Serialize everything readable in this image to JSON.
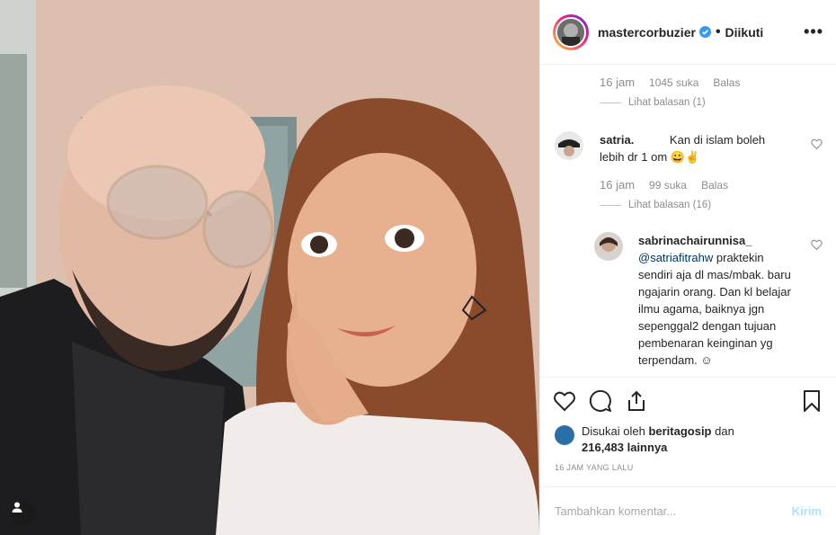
{
  "header": {
    "username": "mastercorbuzier",
    "separator": "•",
    "follow_status": "Diikuti",
    "more": "•••"
  },
  "comments": [
    {
      "meta": {
        "time": "16 jam",
        "likes": "1045 suka",
        "reply": "Balas"
      },
      "view_replies": "Lihat balasan (1)"
    },
    {
      "username": "satria.",
      "text": " Kan di islam boleh lebih dr 1 om 😀✌",
      "meta": {
        "time": "16 jam",
        "likes": "99 suka",
        "reply": "Balas"
      },
      "view_replies": "Lihat balasan (16)"
    },
    {
      "username": "sabrinachairunnisa_",
      "mention": "@satriafitrahw",
      "text": " praktekin sendiri aja dl mas/mbak. baru ngajarin orang. Dan kl belajar ilmu agama, baiknya jgn sepenggal2 dengan tujuan pembenaran keinginan yg terpendam. ☺"
    }
  ],
  "liked_by": {
    "prefix": "Disukai oleh ",
    "user": "beritagosip",
    "connector": " dan",
    "count": "216,483 lainnya"
  },
  "timestamp": "16 JAM YANG LALU",
  "add_comment": {
    "placeholder": "Tambahkan komentar...",
    "send": "Kirim"
  },
  "icons": [
    "heart-icon",
    "comment-icon",
    "share-icon",
    "bookmark-icon",
    "user-tag-icon",
    "verified-icon"
  ],
  "colors": {
    "verified": "#3897f0",
    "send_disabled": "#b2dffc",
    "mention": "#003569"
  }
}
